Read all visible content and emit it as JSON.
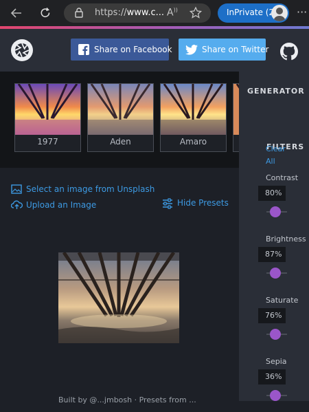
{
  "browser": {
    "url_prefix": "https://",
    "url_host": "www.c...",
    "inprivate_label": "InPrivate (2)"
  },
  "header": {
    "share_facebook": "Share on Facebook",
    "share_twitter": "Share on Twitter",
    "icons": [
      "back-arrow-icon",
      "refresh-icon",
      "lock-icon",
      "read-aloud-icon",
      "favorite-star-icon",
      "camera-aperture-logo-icon",
      "facebook-icon",
      "twitter-icon",
      "github-icon",
      "more-icon"
    ],
    "colors": {
      "facebook": "#3b5998",
      "twitter": "#55acee",
      "accent": "#3d9ae3",
      "slider": "#9a56c9"
    }
  },
  "presets": [
    {
      "label": "1977"
    },
    {
      "label": "Aden"
    },
    {
      "label": "Amaro"
    }
  ],
  "main": {
    "select_unsplash": "Select an image from Unsplash",
    "upload_image": "Upload an Image",
    "hide_presets": "Hide Presets",
    "footer_text": "Built by @...jmbosh · Presets from ..."
  },
  "sidebar": {
    "title": "GENERATOR",
    "filters_title": "FILTERS",
    "clear_label": "Clear All",
    "filters": [
      {
        "name": "Contrast",
        "value": "80%"
      },
      {
        "name": "Brightness",
        "value": "87%"
      },
      {
        "name": "Saturate",
        "value": "76%"
      },
      {
        "name": "Sepia",
        "value": "36%"
      }
    ]
  }
}
